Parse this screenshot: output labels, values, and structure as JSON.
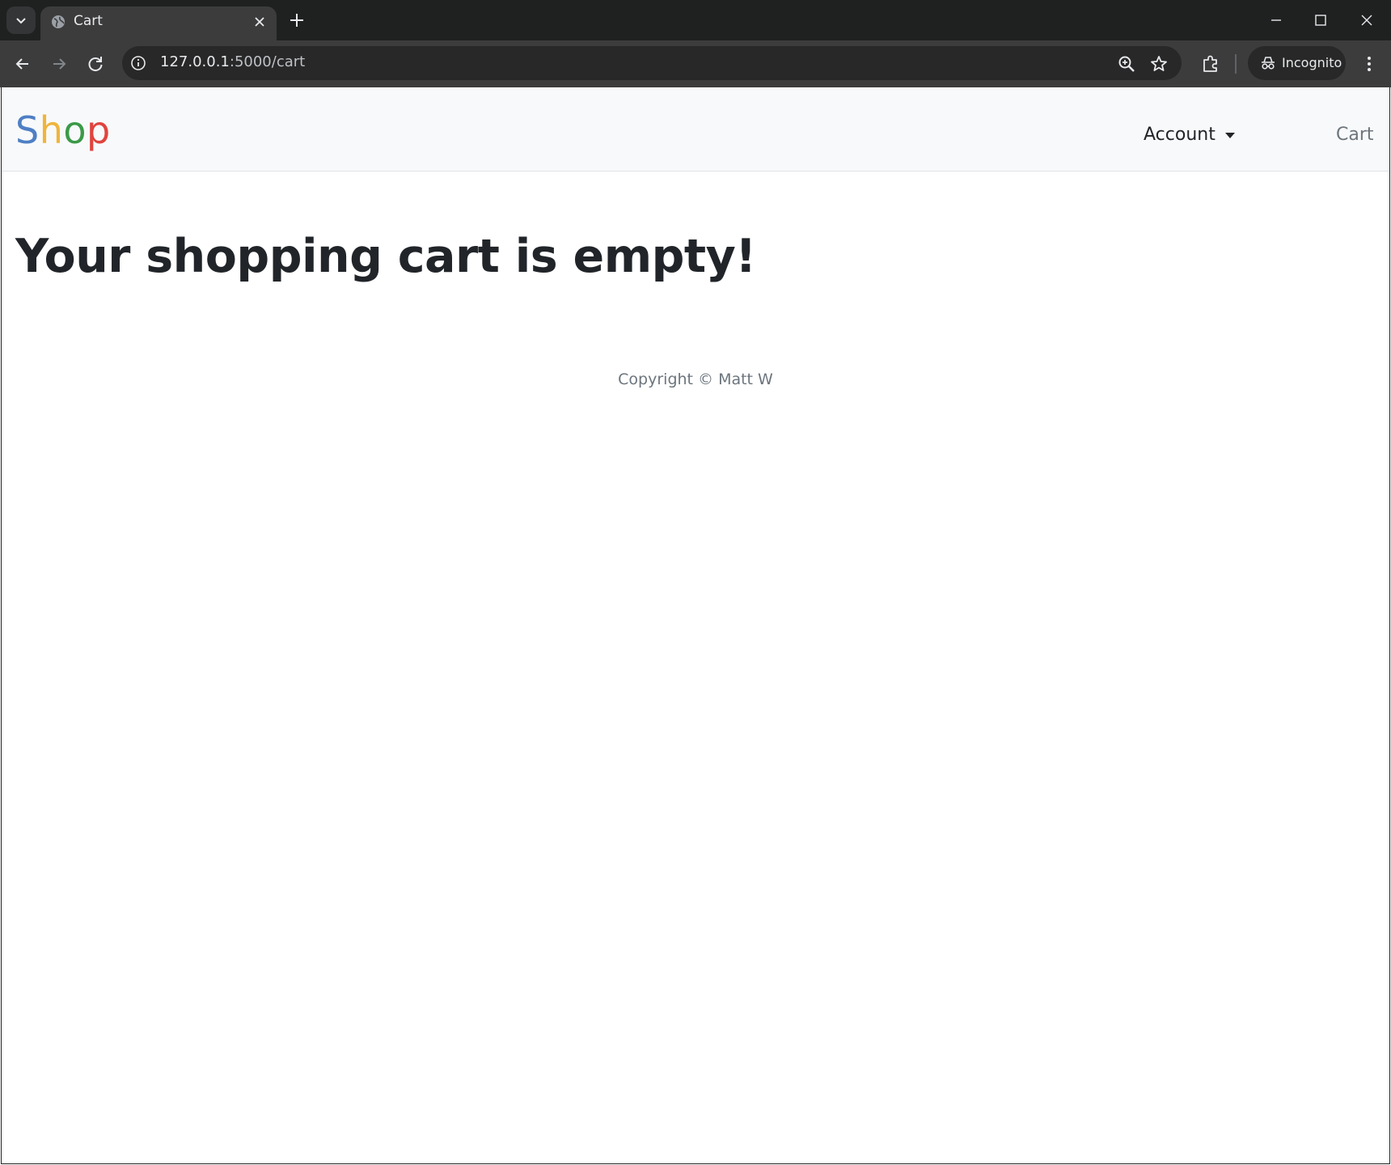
{
  "browser": {
    "tab_title": "Cart",
    "url_host": "127.0.0.1",
    "url_path": ":5000/cart",
    "incognito_label": "Incognito"
  },
  "navbar": {
    "brand_letters": [
      "S",
      "h",
      "o",
      "p"
    ],
    "brand_colors": [
      "#4e7fc4",
      "#f0b43c",
      "#3a9a48",
      "#e0443e"
    ],
    "account_label": "Account",
    "cart_label": "Cart"
  },
  "main": {
    "heading": "Your shopping cart is empty!"
  },
  "footer": {
    "copyright": "Copyright © Matt W"
  },
  "icons": {
    "tab_list": "chevron-down-icon",
    "favicon": "globe-icon",
    "tab_close": "close-icon",
    "new_tab": "plus-icon",
    "back": "arrow-left-icon",
    "forward": "arrow-right-icon",
    "reload": "reload-icon",
    "site_info": "info-icon",
    "zoom": "zoom-in-icon",
    "bookmark": "star-icon",
    "extensions": "puzzle-icon",
    "incognito": "incognito-icon",
    "menu": "more-vertical-icon"
  }
}
